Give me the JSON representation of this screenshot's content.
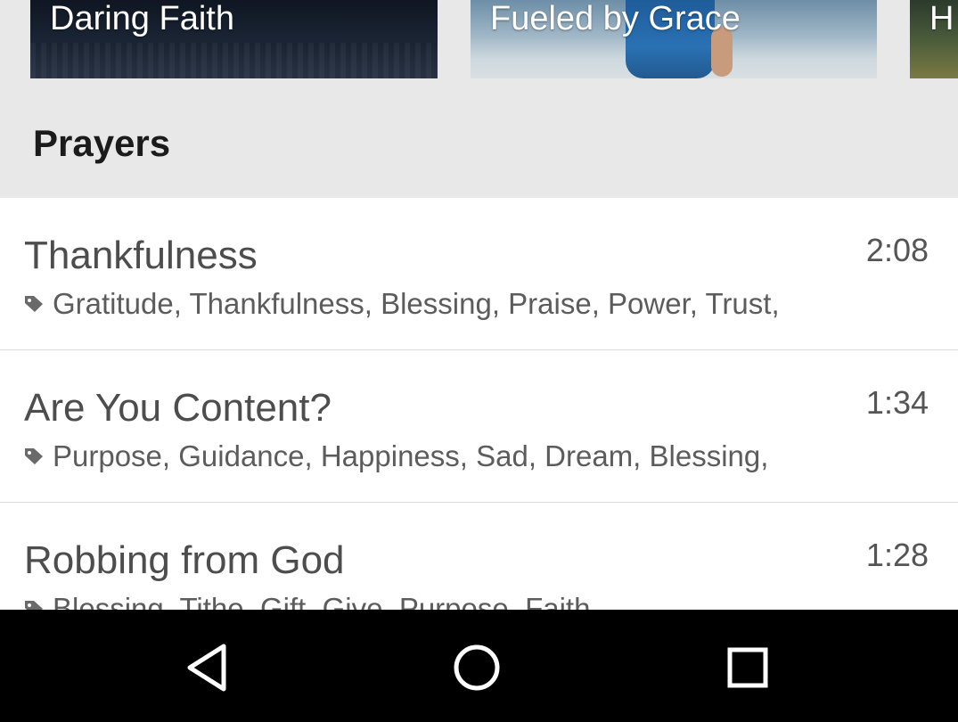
{
  "featured": [
    {
      "title": "Daring Faith"
    },
    {
      "title": "Fueled by Grace"
    },
    {
      "title": "H"
    }
  ],
  "section": {
    "title": "Prayers"
  },
  "prayers": [
    {
      "title": "Thankfulness",
      "duration": "2:08",
      "tags": "Gratitude, Thankfulness, Blessing, Praise, Power, Trust,"
    },
    {
      "title": "Are You Content?",
      "duration": "1:34",
      "tags": "Purpose, Guidance, Happiness, Sad, Dream, Blessing,"
    },
    {
      "title": "Robbing from God",
      "duration": "1:28",
      "tags": "Blessing, Tithe, Gift, Give, Purpose, Faith,"
    }
  ],
  "icons": {
    "tag": "tag-icon",
    "back": "back-icon",
    "home": "home-icon",
    "recents": "recents-icon"
  },
  "colors": {
    "list_background": "#ffffff",
    "section_background": "#e8e8e8",
    "navbar": "#000000"
  }
}
